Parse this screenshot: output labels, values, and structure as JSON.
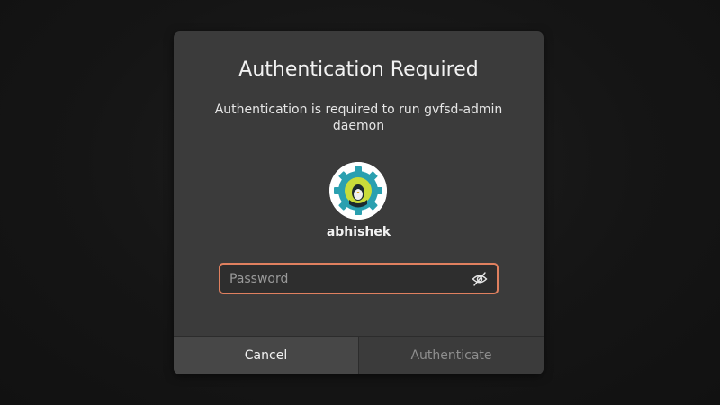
{
  "dialog": {
    "title": "Authentication Required",
    "message": "Authentication is required to run gvfsd-admin daemon",
    "avatar_icon": "gear-avatar-icon",
    "username": "abhishek",
    "password": {
      "value": "",
      "placeholder": "Password",
      "reveal_icon": "eye-slash-icon"
    },
    "buttons": {
      "cancel_label": "Cancel",
      "authenticate_label": "Authenticate"
    }
  },
  "colors": {
    "background": "#141414",
    "dialog_bg": "#3b3b3b",
    "focus_border": "#e0805f",
    "avatar_gear": "#2aa0b0",
    "disabled_text": "#8e8e8e"
  }
}
